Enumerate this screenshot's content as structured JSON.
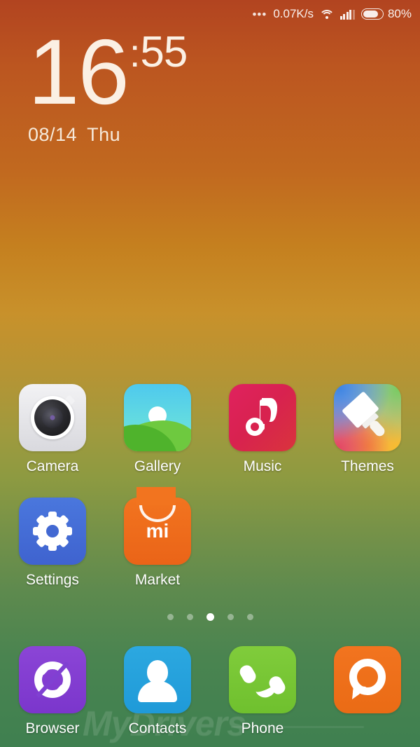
{
  "status_bar": {
    "more_icon": "•••",
    "network_speed": "0.07K/s",
    "wifi_icon": "wifi-icon",
    "signal_icon": "cellular-signal-icon",
    "battery_icon": "battery-icon",
    "battery_percent": "80%",
    "battery_level": 80
  },
  "clock_widget": {
    "hour": "16",
    "separator": ":",
    "minute": "55",
    "date": "08/14",
    "weekday": "Thu"
  },
  "home_screen": {
    "rows": [
      {
        "apps": [
          {
            "label": "Camera",
            "icon": "camera-icon",
            "color": "#e6e6ea"
          },
          {
            "label": "Gallery",
            "icon": "gallery-icon",
            "color": "#4ec9ee"
          },
          {
            "label": "Music",
            "icon": "music-icon",
            "color": "#d8224f"
          },
          {
            "label": "Themes",
            "icon": "themes-icon",
            "color": "#c9bcd8"
          }
        ]
      },
      {
        "apps": [
          {
            "label": "Settings",
            "icon": "settings-icon",
            "color": "#4268d2"
          },
          {
            "label": "Market",
            "icon": "market-icon",
            "color": "#f2741f",
            "logo": "mi"
          }
        ]
      }
    ],
    "dock": {
      "apps": [
        {
          "label": "Browser",
          "icon": "browser-icon",
          "color": "#8040d2"
        },
        {
          "label": "Contacts",
          "icon": "contacts-icon",
          "color": "#2ca8e0"
        },
        {
          "label": "Phone",
          "icon": "phone-icon",
          "color": "#76c634"
        },
        {
          "label": "",
          "icon": "messaging-icon",
          "color": "#f2741f"
        }
      ]
    },
    "page_indicator": {
      "total_pages": 5,
      "active_page": 3
    }
  },
  "watermark": {
    "text": "MyDrivers"
  },
  "wallpaper": {
    "gradient_top": "#b24420",
    "gradient_mid": "#c8912b",
    "gradient_bottom": "#3f8050"
  }
}
